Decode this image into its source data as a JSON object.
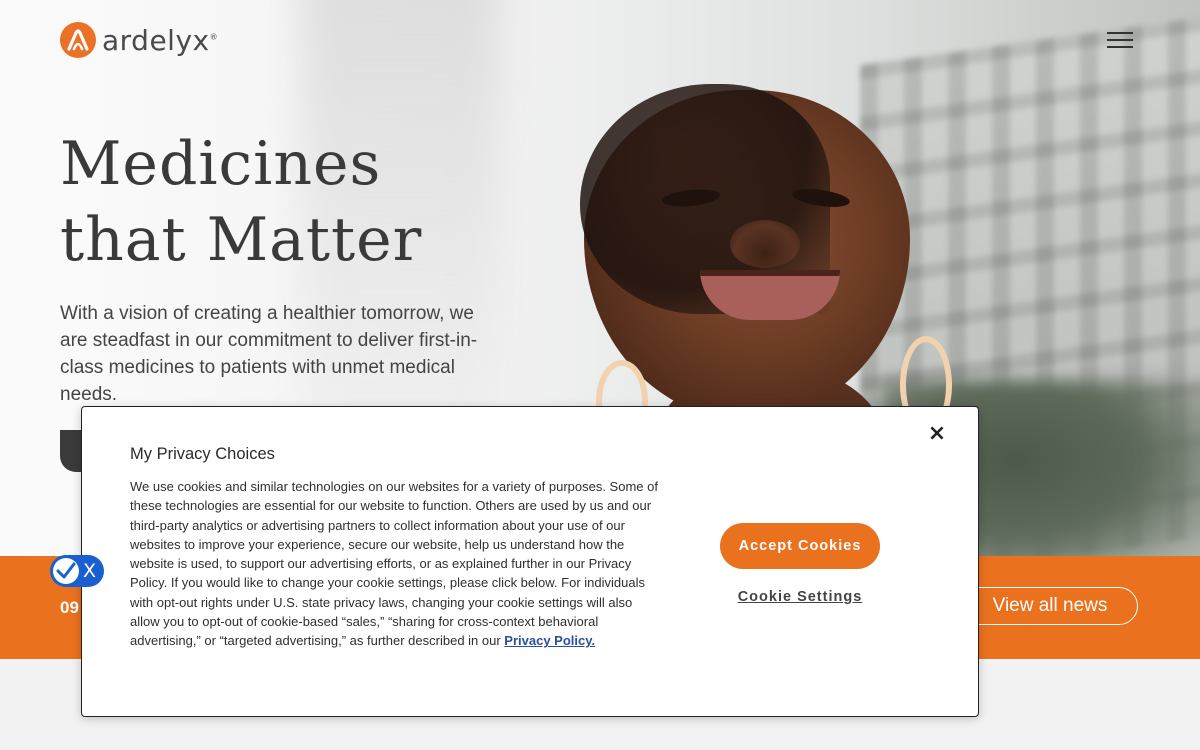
{
  "brand": {
    "name": "ardelyx",
    "reg_mark": "®",
    "accent_color": "#ea711e"
  },
  "header": {
    "menu_icon": "hamburger-menu-icon"
  },
  "hero": {
    "title_line1": "Medicines",
    "title_line2": "that Matter",
    "text": "With a vision of creating a healthier tomorrow, we are steadfast in our commitment to deliver first-in-class medicines to patients with unmet medical needs."
  },
  "news_band": {
    "date_fragment": "09",
    "view_all_label": "View all news"
  },
  "cookie_modal": {
    "title": "My Privacy Choices",
    "body": "We use cookies and similar technologies on our websites for a variety of purposes. Some of these technologies are essential for our website to function. Others are used by us and our third-party analytics or advertising partners to collect information about your use of our websites to improve your experience, secure our website, help us understand how the website is used, to support our advertising efforts, or as explained further in our Privacy Policy. If you would like to change your cookie settings, please click below. For individuals with opt-out rights under U.S. state privacy laws, changing your cookie settings will also allow you to opt-out of cookie-based “sales,” “sharing for cross-context behavioral advertising,” or “targeted advertising,” as further described in our ",
    "policy_link": "Privacy Policy.",
    "accept_label": "Accept Cookies",
    "settings_label": "Cookie Settings",
    "close_symbol": "×"
  },
  "privacy_badge": {
    "check_icon": "check-icon",
    "x_symbol": "X"
  }
}
